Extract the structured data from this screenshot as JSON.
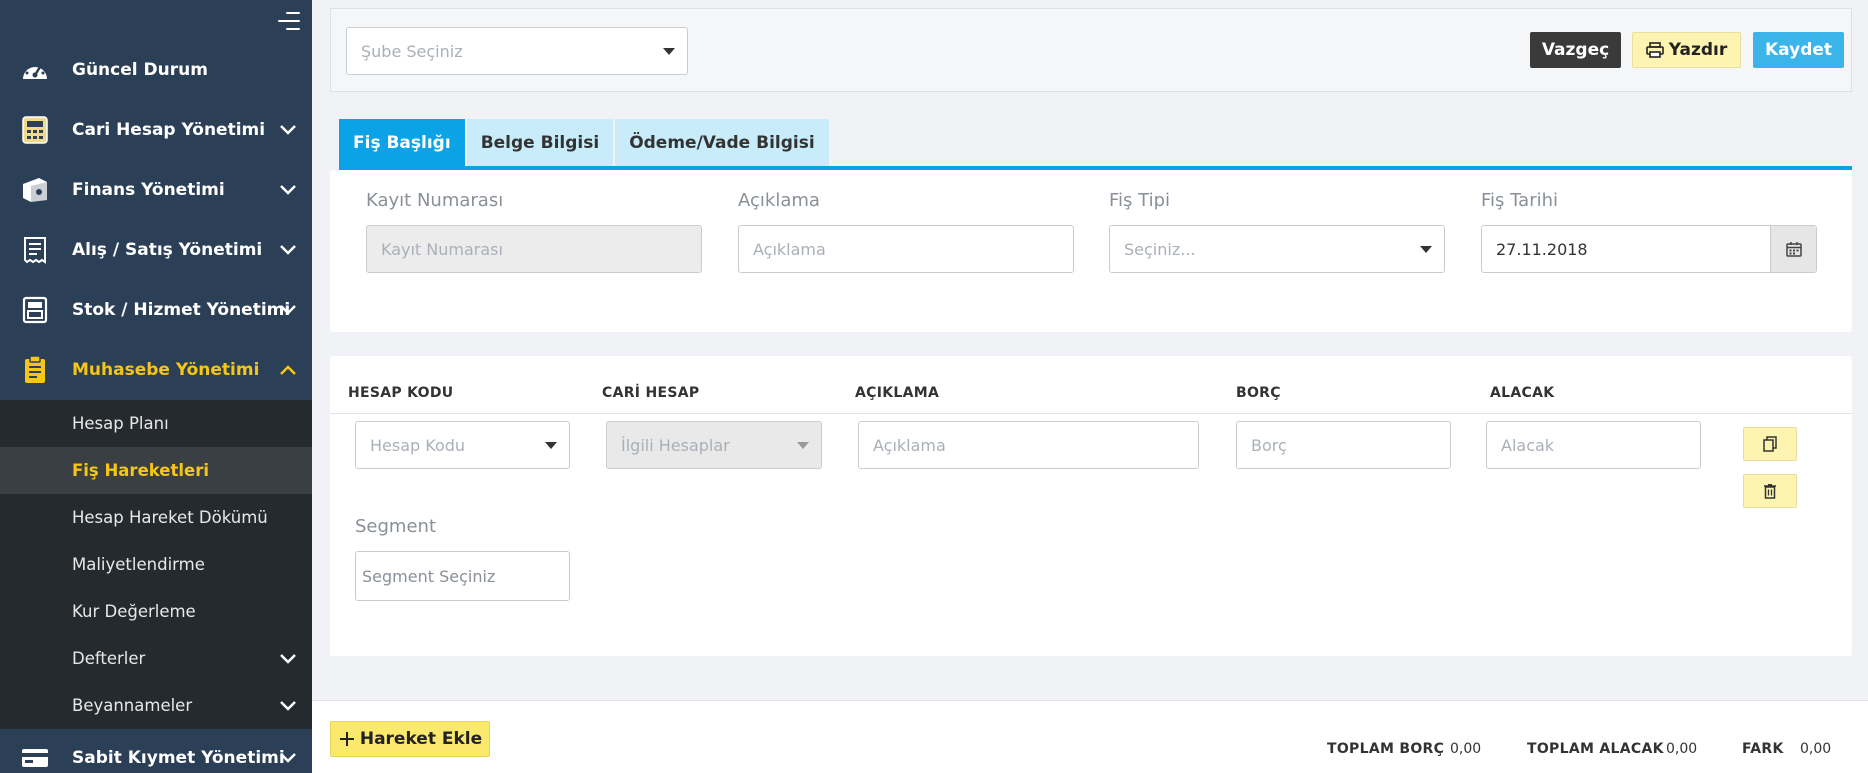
{
  "sidebar": {
    "items": [
      {
        "label": "Güncel Durum",
        "icon": "dashboard-icon"
      },
      {
        "label": "Cari Hesap Yönetimi",
        "icon": "calculator-icon"
      },
      {
        "label": "Finans Yönetimi",
        "icon": "wallet-icon"
      },
      {
        "label": "Alış / Satış Yönetimi",
        "icon": "receipt-icon"
      },
      {
        "label": "Stok / Hizmet Yönetimi",
        "icon": "stock-icon"
      },
      {
        "label": "Muhasebe Yönetimi",
        "icon": "clipboard-icon"
      },
      {
        "label": "Sabit Kıymet Yönetimi",
        "icon": "card-icon"
      }
    ],
    "subitems": [
      {
        "label": "Hesap Planı"
      },
      {
        "label": "Fiş Hareketleri"
      },
      {
        "label": "Hesap Hareket Dökümü"
      },
      {
        "label": "Maliyetlendirme"
      },
      {
        "label": "Kur Değerleme"
      },
      {
        "label": "Defterler"
      },
      {
        "label": "Beyannameler"
      }
    ]
  },
  "topbar": {
    "branch_placeholder": "Şube Seçiniz",
    "cancel_label": "Vazgeç",
    "print_label": "Yazdır",
    "save_label": "Kaydet"
  },
  "tabs": [
    {
      "label": "Fiş Başlığı"
    },
    {
      "label": "Belge Bilgisi"
    },
    {
      "label": "Ödeme/Vade Bilgisi"
    }
  ],
  "header_form": {
    "record_no_label": "Kayıt Numarası",
    "record_no_placeholder": "Kayıt Numarası",
    "description_label": "Açıklama",
    "description_placeholder": "Açıklama",
    "type_label": "Fiş Tipi",
    "type_placeholder": "Seçiniz...",
    "date_label": "Fiş Tarihi",
    "date_value": "27.11.2018"
  },
  "lines": {
    "columns": [
      "HESAP KODU",
      "CARİ HESAP",
      "AÇIKLAMA",
      "BORÇ",
      "ALACAK"
    ],
    "row": {
      "account_code_placeholder": "Hesap Kodu",
      "related_accounts_placeholder": "İlgili Hesaplar",
      "description_placeholder": "Açıklama",
      "debit_placeholder": "Borç",
      "credit_placeholder": "Alacak",
      "segment_label": "Segment",
      "segment_placeholder": "Segment Seçiniz"
    }
  },
  "footer": {
    "add_label": "Hareket Ekle",
    "total_debit_label": "TOPLAM BORÇ",
    "total_debit_value": "0,00",
    "total_credit_label": "TOPLAM ALACAK",
    "total_credit_value": "0,00",
    "diff_label": "FARK",
    "diff_value": "0,00"
  },
  "colors": {
    "sidebar_bg": "#2b3f56",
    "accent_yellow": "#f5c518",
    "primary_blue": "#0ca3e6"
  }
}
